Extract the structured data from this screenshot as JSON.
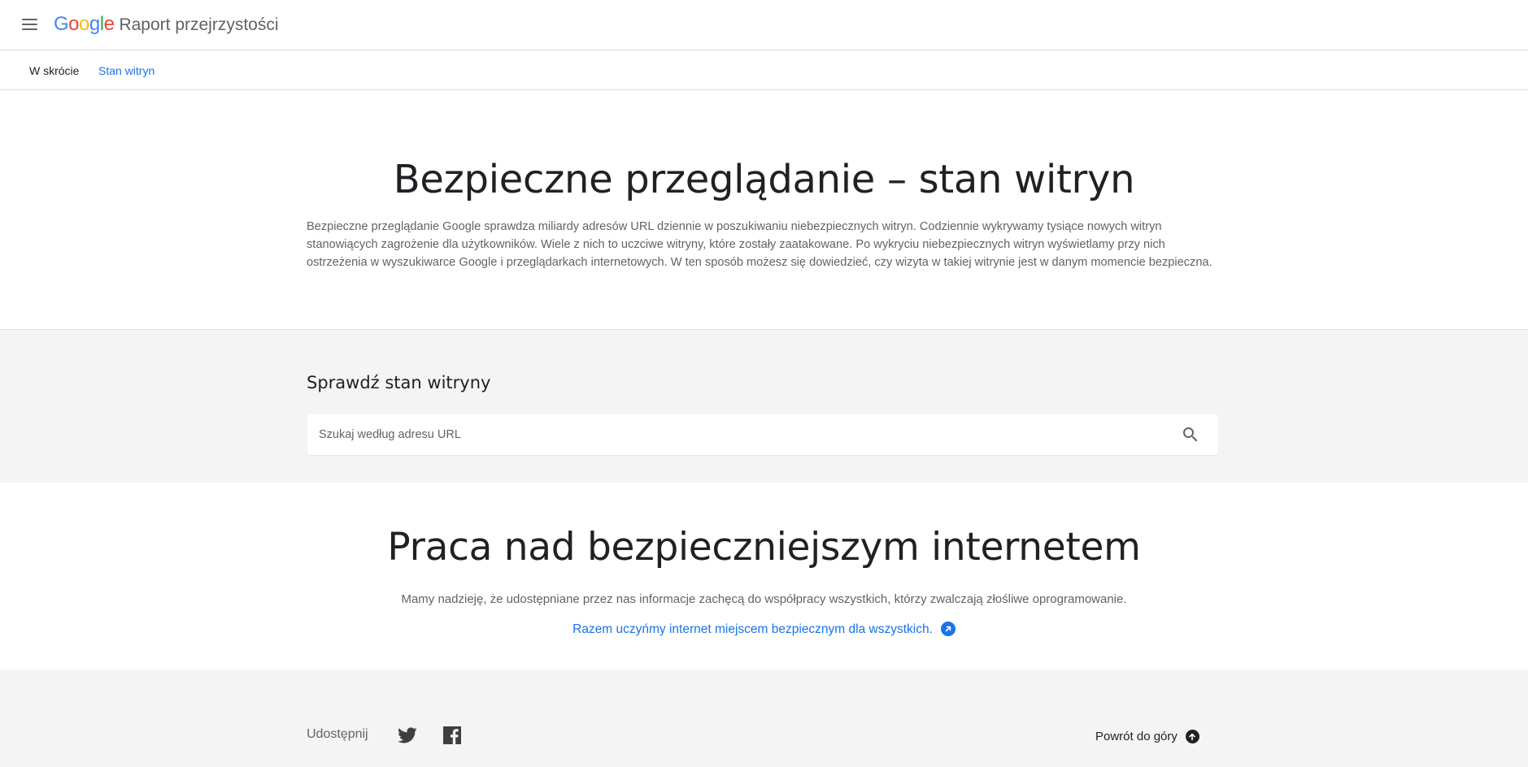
{
  "header": {
    "logo_text": "Google",
    "logo_colors": [
      "#4285F4",
      "#EA4335",
      "#FBBC05",
      "#4285F4",
      "#34A853",
      "#EA4335"
    ],
    "app_title": "Raport przejrzystości",
    "menu_icon": "hamburger-menu-icon"
  },
  "tabs": [
    {
      "label": "W skrócie",
      "active": false
    },
    {
      "label": "Stan witryn",
      "active": true
    }
  ],
  "hero": {
    "title": "Bezpieczne przeglądanie – stan witryn",
    "description": "Bezpieczne przeglądanie Google sprawdza miliardy adresów URL dziennie w poszukiwaniu niebezpiecznych witryn. Codziennie wykrywamy tysiące nowych witryn stanowiących zagrożenie dla użytkowników. Wiele z nich to uczciwe witryny, które zostały zaatakowane. Po wykryciu niebezpiecznych witryn wyświetlamy przy nich ostrzeżenia w wyszukiwarce Google i przeglądarkach internetowych. W ten sposób możesz się dowiedzieć, czy wizyta w takiej witrynie jest w danym momencie bezpieczna."
  },
  "search": {
    "title": "Sprawdź stan witryny",
    "placeholder": "Szukaj według adresu URL",
    "value": "",
    "icon": "search-icon"
  },
  "safer_web": {
    "title": "Praca nad bezpieczniejszym internetem",
    "description": "Mamy nadzieję, że udostępniane przez nas informacje zachęcą do współpracy wszystkich, którzy zwalczają złośliwe oprogramowanie.",
    "link_text": "Razem uczyńmy internet miejscem bezpiecznym dla wszystkich.",
    "link_icon": "arrow-up-right-circle-icon"
  },
  "footer": {
    "share_label": "Udostępnij",
    "share_icons": [
      "twitter-icon",
      "facebook-icon"
    ],
    "back_to_top": "Powrót do góry",
    "back_to_top_icon": "arrow-up-circle-icon"
  },
  "colors": {
    "accent": "#1a73e8",
    "text_primary": "#202124",
    "text_secondary": "#5f6368",
    "section_gray": "#f4f4f4",
    "divider": "#dadce0"
  }
}
